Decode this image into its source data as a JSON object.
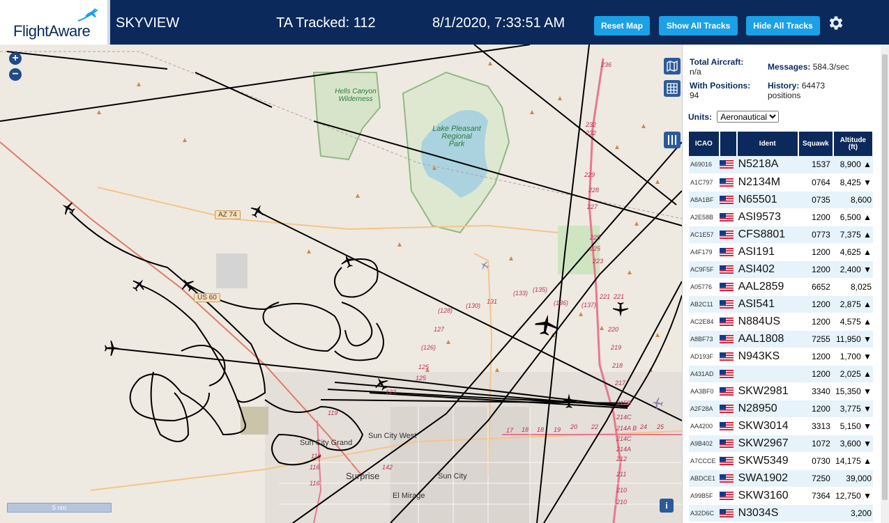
{
  "header": {
    "logo_text": "FlightAware",
    "app_title": "SKYVIEW",
    "tracked_label": "TA Tracked: 112",
    "clock": "8/1/2020, 7:33:51 AM",
    "reset_map": "Reset Map",
    "show_all_tracks": "Show All Tracks",
    "hide_all_tracks": "Hide All Tracks",
    "settings_icon": "gear-icon"
  },
  "map": {
    "zoom_in": "+",
    "zoom_out": "−",
    "scale": "5 nm",
    "info": "i",
    "labels": {
      "hells_canyon": "Hells Canyon\nWilderness",
      "lake_pleasant": "Lake Pleasant\nRegional\nPark",
      "az74": "AZ 74",
      "us60": "US 60",
      "sun_city_grand": "Sun City Grand",
      "sun_city_west": "Sun City West",
      "surprise": "Surprise",
      "sun_city": "Sun City",
      "el_mirage": "El Mirage"
    },
    "route_numbers": [
      "236",
      "232",
      "232",
      "229",
      "228",
      "227",
      "225",
      "225",
      "223",
      "221",
      "221",
      "220",
      "219",
      "218",
      "217",
      "215B",
      "214C",
      "214A B",
      "214C",
      "214A",
      "212",
      "211",
      "210",
      "210",
      "(128)",
      "(130)",
      "131",
      "(133)",
      "(135)",
      "(136)",
      "(137)",
      "127",
      "(126)",
      "125",
      "125",
      "123",
      "119",
      "116",
      "116",
      "116",
      "142",
      "17",
      "18",
      "18",
      "19",
      "20",
      "22",
      "24",
      "25"
    ]
  },
  "sidebar": {
    "stats": {
      "total_aircraft_label": "Total Aircraft:",
      "total_aircraft_value": "n/a",
      "with_positions_label": "With Positions:",
      "with_positions_value": "94",
      "messages_label": "Messages:",
      "messages_value": "584.3/sec",
      "history_label": "History:",
      "history_value": "64473",
      "history_unit": "positions"
    },
    "units_label": "Units:",
    "units_value": "Aeronautical",
    "columns": {
      "icao": "ICAO",
      "ident": "Ident",
      "squawk": "Squawk",
      "altitude": "Altitude",
      "altitude_unit": "(ft)"
    },
    "rows": [
      {
        "icao": "A69016",
        "ident": "N5218A",
        "squawk": "1537",
        "alt": "8,900 ▲"
      },
      {
        "icao": "A1C797",
        "ident": "N2134M",
        "squawk": "0764",
        "alt": "8,425 ▼"
      },
      {
        "icao": "A8A1BF",
        "ident": "N65501",
        "squawk": "0735",
        "alt": "8,600"
      },
      {
        "icao": "A2E58B",
        "ident": "ASI9573",
        "squawk": "1200",
        "alt": "6,500 ▲"
      },
      {
        "icao": "AC1E57",
        "ident": "CFS8801",
        "squawk": "0773",
        "alt": "7,375 ▲"
      },
      {
        "icao": "A4F179",
        "ident": "ASI191",
        "squawk": "1200",
        "alt": "4,625 ▲"
      },
      {
        "icao": "AC9F5F",
        "ident": "ASI402",
        "squawk": "1200",
        "alt": "2,400 ▼"
      },
      {
        "icao": "A05776",
        "ident": "AAL2859",
        "squawk": "6652",
        "alt": "8,025"
      },
      {
        "icao": "AB2C11",
        "ident": "ASI541",
        "squawk": "1200",
        "alt": "2,875 ▲"
      },
      {
        "icao": "AC2E84",
        "ident": "N884US",
        "squawk": "1200",
        "alt": "4,575 ▲"
      },
      {
        "icao": "A8BF73",
        "ident": "AAL1808",
        "squawk": "7255",
        "alt": "11,950 ▼"
      },
      {
        "icao": "AD193F",
        "ident": "N943KS",
        "squawk": "1200",
        "alt": "1,700 ▼"
      },
      {
        "icao": "A431AD",
        "ident": "",
        "squawk": "1200",
        "alt": "2,025 ▲"
      },
      {
        "icao": "AA3BF0",
        "ident": "SKW2981",
        "squawk": "3340",
        "alt": "15,350 ▼"
      },
      {
        "icao": "A2F28A",
        "ident": "N28950",
        "squawk": "1200",
        "alt": "3,775 ▼"
      },
      {
        "icao": "AA4200",
        "ident": "SKW3014",
        "squawk": "3313",
        "alt": "5,150 ▼"
      },
      {
        "icao": "A9B402",
        "ident": "SKW2967",
        "squawk": "1072",
        "alt": "3,600 ▼"
      },
      {
        "icao": "A7CCCE",
        "ident": "SKW5349",
        "squawk": "0730",
        "alt": "14,175 ▲"
      },
      {
        "icao": "ABDCE1",
        "ident": "SWA1902",
        "squawk": "7250",
        "alt": "39,000"
      },
      {
        "icao": "A99B5F",
        "ident": "SKW3160",
        "squawk": "7364",
        "alt": "12,750 ▼"
      },
      {
        "icao": "A32D6C",
        "ident": "N3034S",
        "squawk": "",
        "alt": "3,200"
      }
    ]
  }
}
